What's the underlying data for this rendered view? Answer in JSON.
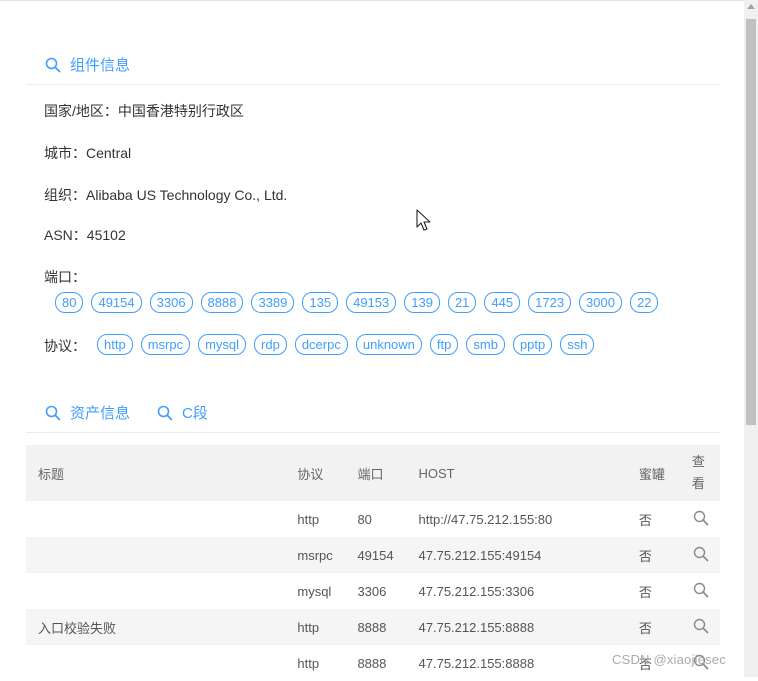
{
  "component_section": {
    "title": "组件信息"
  },
  "info": {
    "country_label": "国家/地区：",
    "country_value": "中国香港特别行政区",
    "city_label": "城市：",
    "city_value": "Central",
    "org_label": "组织：",
    "org_value": "Alibaba US Technology Co., Ltd.",
    "asn_label": "ASN：",
    "asn_value": "45102",
    "ports_label": "端口：",
    "protocols_label": "协议："
  },
  "ports": [
    "80",
    "49154",
    "3306",
    "8888",
    "3389",
    "135",
    "49153",
    "139",
    "21",
    "445",
    "1723",
    "3000",
    "22"
  ],
  "protocols": [
    "http",
    "msrpc",
    "mysql",
    "rdp",
    "dcerpc",
    "unknown",
    "ftp",
    "smb",
    "pptp",
    "ssh"
  ],
  "asset_section": {
    "asset_tab": "资产信息",
    "c_segment_tab": "C段"
  },
  "table": {
    "headers": {
      "title": "标题",
      "protocol": "协议",
      "port": "端口",
      "host": "HOST",
      "honeypot": "蜜罐",
      "view": "查看"
    },
    "rows": [
      {
        "title": "",
        "protocol": "http",
        "port": "80",
        "host": "http://47.75.212.155:80",
        "honeypot": "否"
      },
      {
        "title": "",
        "protocol": "msrpc",
        "port": "49154",
        "host": "47.75.212.155:49154",
        "honeypot": "否"
      },
      {
        "title": "",
        "protocol": "mysql",
        "port": "3306",
        "host": "47.75.212.155:3306",
        "honeypot": "否"
      },
      {
        "title": "入口校验失败",
        "protocol": "http",
        "port": "8888",
        "host": "47.75.212.155:8888",
        "honeypot": "否"
      },
      {
        "title": "",
        "protocol": "http",
        "port": "8888",
        "host": "47.75.212.155:8888",
        "honeypot": "否"
      }
    ]
  },
  "watermark": "CSDN @xiaojiesec",
  "colors": {
    "accent": "#409eff",
    "header_bg": "#f2f2f2",
    "alt_row_bg": "#f5f5f5"
  }
}
